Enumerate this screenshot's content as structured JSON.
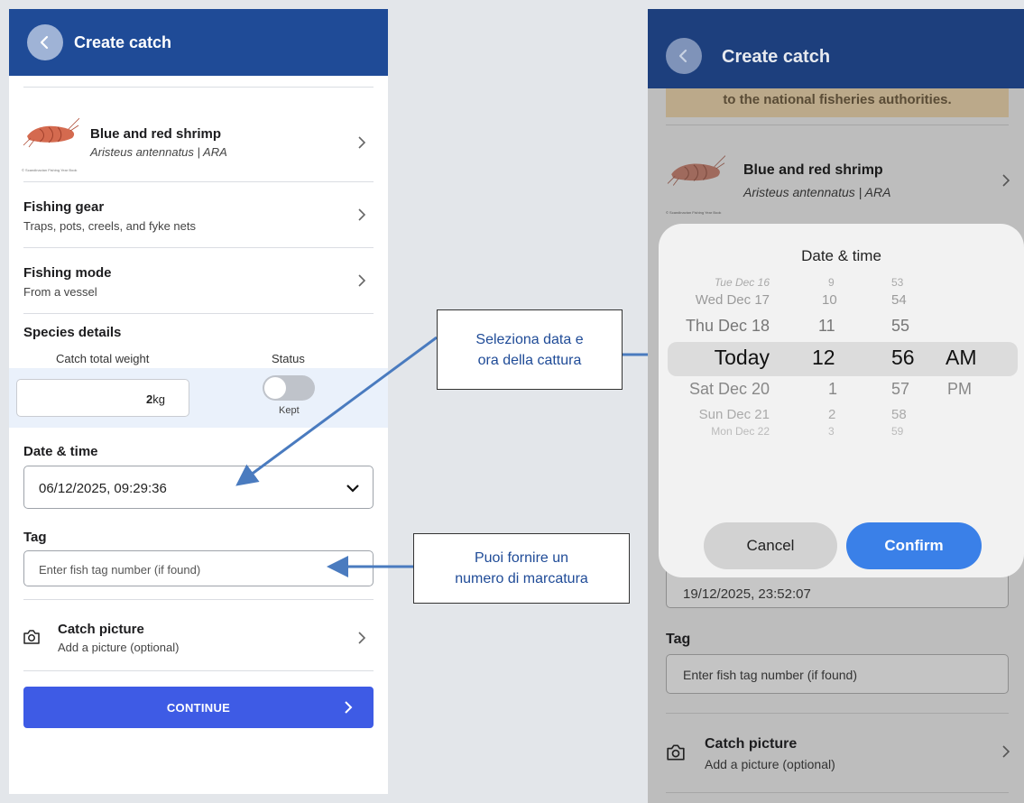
{
  "left": {
    "header": {
      "title": "Create catch"
    },
    "species": {
      "name": "Blue and red shrimp",
      "scientific": "Aristeus antennatus | ARA",
      "credit": "© Scandinavian Fishing Year Book"
    },
    "gear": {
      "title": "Fishing gear",
      "value": "Traps, pots, creels, and fyke nets"
    },
    "mode": {
      "title": "Fishing mode",
      "value": "From a vessel"
    },
    "details": {
      "title": "Species details",
      "weight_label": "Catch total weight",
      "status_label": "Status",
      "weight_value": "2",
      "weight_unit": "kg",
      "status_value": "Kept"
    },
    "datetime": {
      "label": "Date & time",
      "value": "06/12/2025, 09:29:36"
    },
    "tag": {
      "label": "Tag",
      "placeholder": "Enter fish tag number (if found)"
    },
    "picture": {
      "title": "Catch picture",
      "sub": "Add a picture (optional)"
    },
    "continue_label": "CONTINUE"
  },
  "callouts": {
    "datetime": [
      "Seleziona data e",
      "ora della cattura"
    ],
    "tag": [
      "Puoi fornire un",
      "numero di marcatura"
    ]
  },
  "right": {
    "header": {
      "title": "Create catch"
    },
    "warning": "to the national fisheries authorities.",
    "species": {
      "name": "Blue and red shrimp",
      "scientific": "Aristeus antennatus | ARA",
      "credit": "© Scandinavian Fishing Year Book"
    },
    "modal": {
      "title": "Date & time",
      "days": [
        "Tue Dec 16",
        "Wed Dec 17",
        "Thu Dec 18",
        "Today",
        "Sat Dec 20",
        "Sun Dec 21",
        "Mon Dec 22"
      ],
      "hours": [
        "9",
        "10",
        "11",
        "12",
        "1",
        "2",
        "3"
      ],
      "minutes": [
        "53",
        "54",
        "55",
        "56",
        "57",
        "58",
        "59"
      ],
      "ampm": [
        "AM",
        "PM"
      ],
      "cancel": "Cancel",
      "confirm": "Confirm"
    },
    "datetime_partial": "19/12/2025, 23:52:07",
    "tag": {
      "label": "Tag",
      "placeholder": "Enter fish tag number (if found)"
    },
    "picture": {
      "title": "Catch picture",
      "sub": "Add a picture (optional)"
    }
  },
  "colors": {
    "appbar": "#1f4b97",
    "continue": "#3e5be5",
    "confirm": "#3a80e8",
    "callout_text": "#1f4b97",
    "arrow": "#4a7bbf"
  }
}
